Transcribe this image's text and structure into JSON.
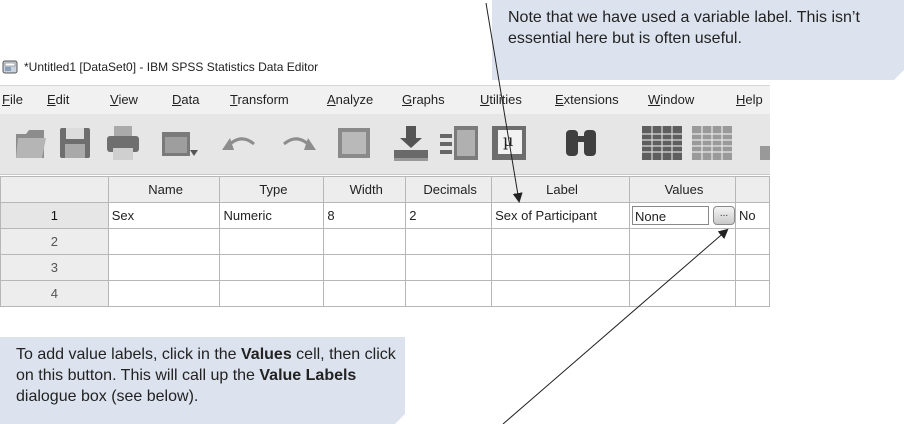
{
  "callouts": {
    "top": "Note that we have used a variable label. This isn’t essential here but is often useful.",
    "bottom_parts": [
      "To add value labels, click in the ",
      "Values",
      " cell, then click on this button. This will call up the ",
      "Value Labels",
      " dialogue box (see below)."
    ]
  },
  "window": {
    "title": "*Untitled1 [DataSet0] - IBM SPSS Statistics Data Editor"
  },
  "menu": [
    "File",
    "Edit",
    "View",
    "Data",
    "Transform",
    "Analyze",
    "Graphs",
    "Utilities",
    "Extensions",
    "Window",
    "Help"
  ],
  "toolbar_icons": [
    "open-folder-icon",
    "save-icon",
    "print-icon",
    "dialog-recall-icon",
    "undo-icon",
    "redo-icon",
    "go-to-case-icon",
    "go-to-variable-icon",
    "variables-icon",
    "value-labels-icon",
    "find-icon",
    "insert-cases-icon",
    "insert-variable-icon"
  ],
  "grid": {
    "columns": [
      "Name",
      "Type",
      "Width",
      "Decimals",
      "Label",
      "Values",
      ""
    ],
    "rows": [
      {
        "num": "1",
        "cells": [
          "Sex",
          "Numeric",
          "8",
          "2",
          "Sex of Participant",
          "None",
          "No"
        ]
      },
      {
        "num": "2",
        "cells": [
          "",
          "",
          "",
          "",
          "",
          "",
          ""
        ]
      },
      {
        "num": "3",
        "cells": [
          "",
          "",
          "",
          "",
          "",
          "",
          ""
        ]
      },
      {
        "num": "4",
        "cells": [
          "",
          "",
          "",
          "",
          "",
          "",
          ""
        ]
      }
    ],
    "values_button": "..."
  }
}
